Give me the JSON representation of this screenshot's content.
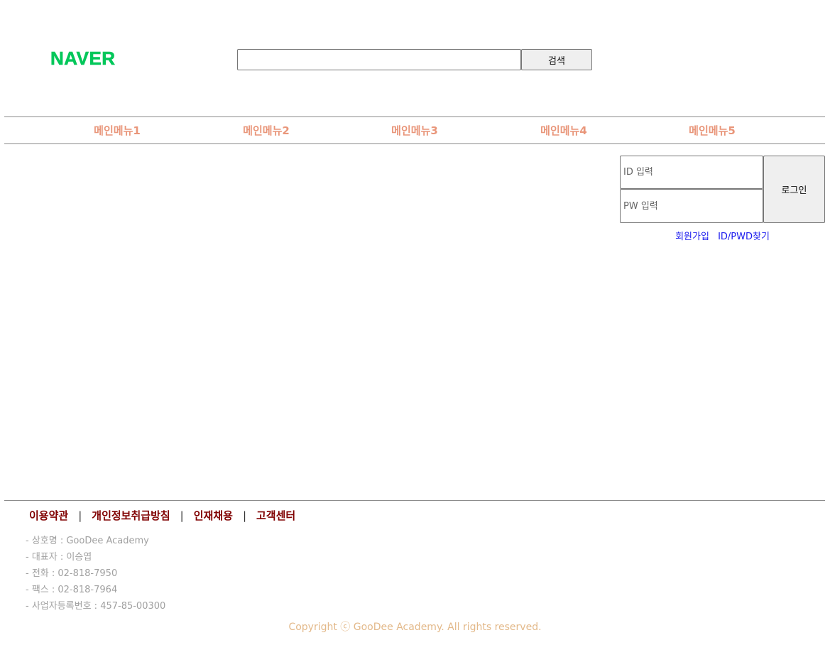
{
  "header": {
    "logo_text": "NAVER",
    "search": {
      "value": "",
      "placeholder": "",
      "button_label": "검색"
    }
  },
  "nav": {
    "items": [
      {
        "label": "메인메뉴1"
      },
      {
        "label": "메인메뉴2"
      },
      {
        "label": "메인메뉴3"
      },
      {
        "label": "메인메뉴4"
      },
      {
        "label": "메인메뉴5"
      }
    ]
  },
  "login": {
    "id_placeholder": "ID 입력",
    "pw_placeholder": "PW 입력",
    "button_label": "로그인",
    "signup_link": "회원가입",
    "find_link": "ID/PWD찾기"
  },
  "footer": {
    "links": [
      "이용약관",
      "개인정보취급방침",
      "인재채용",
      "고객센터"
    ],
    "separator": "|",
    "info": [
      "- 상호명 : GooDee Academy",
      "- 대표자 : 이승엽",
      "- 전화 : 02-818-7950",
      "- 팩스 : 02-818-7964",
      "- 사업자등록번호 : 457-85-00300"
    ],
    "copyright": "Copyright ⓒ GooDee Academy. All rights reserved."
  },
  "colors": {
    "logo": "#03c75a",
    "nav_text": "#e9967a",
    "footer_link": "#800000",
    "login_link": "#1a1aee",
    "info_text": "#a0a0a0",
    "copyright": "#e3b98a"
  }
}
